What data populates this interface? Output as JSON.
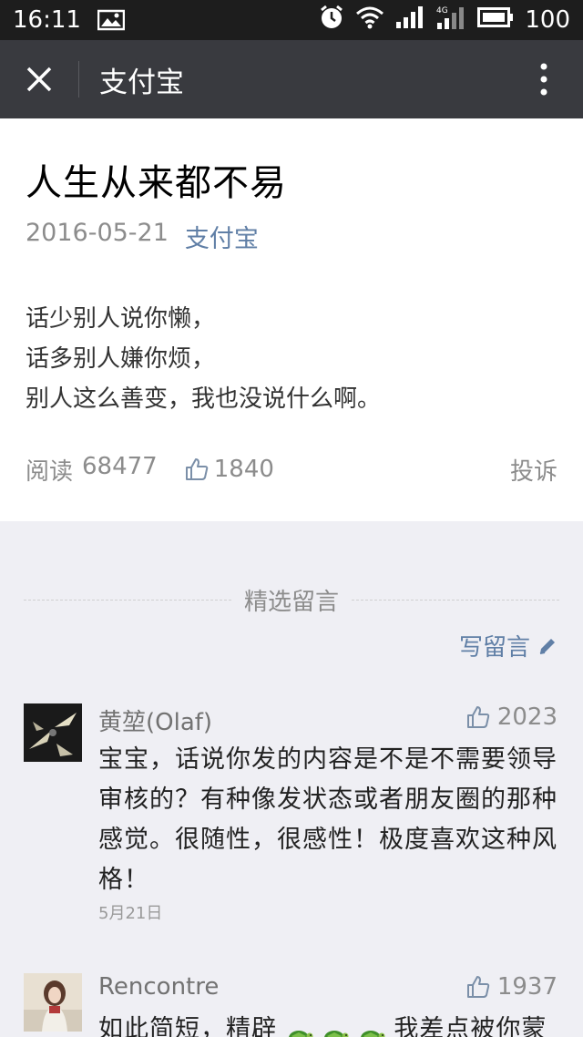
{
  "status_bar": {
    "time": "16:11",
    "battery": "100",
    "icons": [
      "image-icon",
      "alarm-icon",
      "wifi-icon",
      "signal-icon",
      "4g-signal-icon",
      "battery-icon"
    ]
  },
  "title_bar": {
    "title": "支付宝",
    "close_icon": "close-icon",
    "more_icon": "more-vertical-icon"
  },
  "article": {
    "title": "人生从来都不易",
    "date": "2016-05-21",
    "author": "支付宝",
    "lines": [
      "话少别人说你懒，",
      "话多别人嫌你烦，",
      "别人这么善变，我也没说什么啊。"
    ],
    "reads_label": "阅读",
    "reads_count": "68477",
    "likes_count": "1840",
    "report_label": "投诉"
  },
  "comments_section": {
    "header": "精选留言",
    "write_label": "写留言",
    "comments": [
      {
        "name": "黄堃(Olaf)",
        "likes": "2023",
        "text": "宝宝，话说你发的内容是不是不需要领导审核的？有种像发状态或者朋友圈的那种感觉。很随性，很感性！极度喜欢这种风格！",
        "date": "5月21日"
      },
      {
        "name": "Rencontre",
        "likes": "1937",
        "text_before_emoji": "如此简短，精辟",
        "text_after_emoji": "我差点被你蒙",
        "date": ""
      }
    ]
  },
  "colors": {
    "title_bar_bg": "#393a3f",
    "link_blue": "#607fa6",
    "page_bg": "#efeff4"
  }
}
